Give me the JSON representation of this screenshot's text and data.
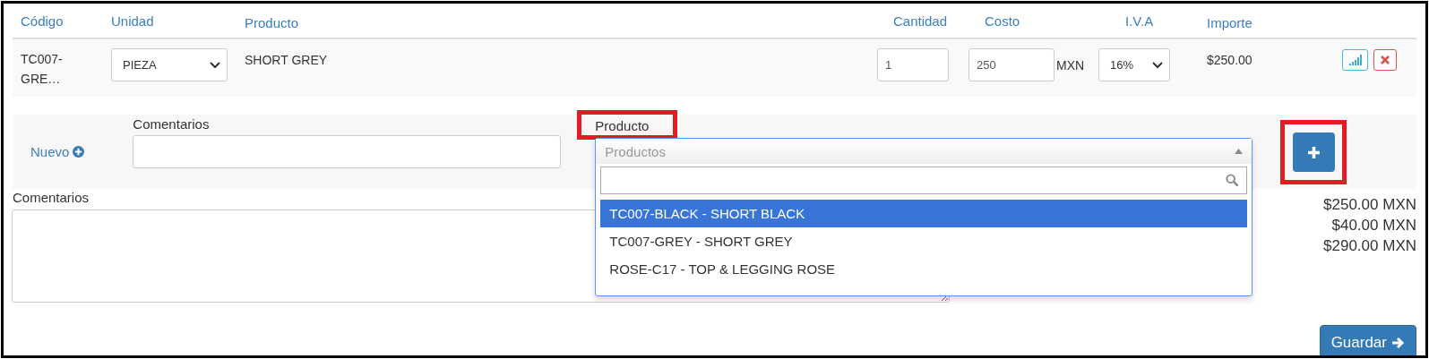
{
  "table": {
    "columns": [
      "Código",
      "Unidad",
      "Producto",
      "Cantidad",
      "Costo",
      "I.V.A",
      "Importe"
    ],
    "rows": [
      {
        "code": "TC007-GRE…",
        "unit": "PIEZA",
        "product": "SHORT GREY",
        "quantity": "1",
        "cost": "250",
        "currency": "MXN",
        "iva": "16%",
        "amount": "$250.00"
      }
    ]
  },
  "add_line": {
    "new_link": "Nuevo",
    "comment_label": "Comentarios",
    "product_label": "Producto",
    "product_placeholder": "Productos",
    "options": [
      {
        "label": "TC007-BLACK - SHORT BLACK",
        "selected": true
      },
      {
        "label": "TC007-GREY - SHORT GREY",
        "selected": false
      },
      {
        "label": "ROSE-C17 - TOP & LEGGING ROSE",
        "selected": false
      }
    ]
  },
  "comments": {
    "label": "Comentarios"
  },
  "totals": [
    "$250.00 MXN",
    "$40.00 MXN",
    "$290.00 MXN"
  ],
  "save_button": "Guardar"
}
